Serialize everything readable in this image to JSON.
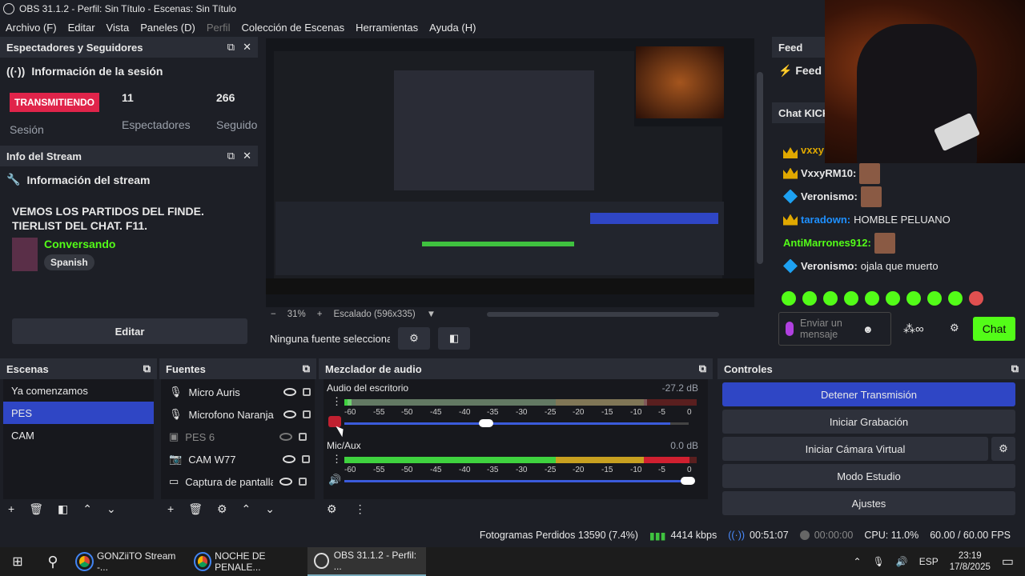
{
  "window": {
    "title": "OBS 31.1.2 - Perfil: Sin Título - Escenas: Sin Título"
  },
  "menu": {
    "items": [
      "Archivo (F)",
      "Editar",
      "Vista",
      "Paneles (D)",
      "Perfil",
      "Colección de Escenas",
      "Herramientas",
      "Ayuda (H)"
    ]
  },
  "viewers": {
    "title": "Espectadores y Seguidores",
    "session_header": "Información de la sesión",
    "status": "TRANSMITIENDO",
    "session_label": "Sesión",
    "viewers_count": "11",
    "viewers_label": "Espectadores",
    "followers_count": "266",
    "followers_label": "Seguido"
  },
  "stream_info": {
    "title": "Info del Stream",
    "header": "Información del stream",
    "stream_title": "VEMOS LOS PARTIDOS DEL FINDE. TIERLIST DEL CHAT. F11.",
    "category": "Conversando",
    "language": "Spanish",
    "edit_label": "Editar"
  },
  "preview": {
    "zoom": "31%",
    "scaling": "Escalado (596x335)",
    "no_source": "Ninguna fuente seleccionad"
  },
  "feed": {
    "title": "Feed",
    "sub": "Feed"
  },
  "chat": {
    "title": "Chat KICK",
    "messages": [
      {
        "user": "VxxyRM10:",
        "text": ""
      },
      {
        "user": "Veronismo:",
        "text": ""
      },
      {
        "user": "taradown:",
        "text": "HOMBLE PELUANO"
      },
      {
        "user": "AntiMarrones912:",
        "text": ""
      },
      {
        "user": "Veronismo:",
        "text": "ojala que muerto"
      }
    ],
    "input_placeholder": "Enviar un mensaje",
    "send_label": "Chat"
  },
  "scenes": {
    "title": "Escenas",
    "items": [
      "Ya comenzamos",
      "PES",
      "CAM"
    ],
    "selected": 1
  },
  "sources": {
    "title": "Fuentes",
    "items": [
      "Micro Auris",
      "Microfono Naranja",
      "PES 6",
      "CAM W77",
      "Captura de pantalla"
    ]
  },
  "mixer": {
    "title": "Mezclador de audio",
    "tracks": [
      {
        "name": "Audio del escritorio",
        "db": "-27.2 dB",
        "level": 0.02,
        "volume": 0.97
      },
      {
        "name": "Mic/Aux",
        "db": "0.0 dB",
        "level": 0.98,
        "volume": 1.0
      }
    ],
    "scale": [
      "-60",
      "-55",
      "-50",
      "-45",
      "-40",
      "-35",
      "-30",
      "-25",
      "-20",
      "-15",
      "-10",
      "-5",
      "0"
    ]
  },
  "controls": {
    "title": "Controles",
    "stop_stream": "Detener Transmisión",
    "start_record": "Iniciar Grabación",
    "virtual_cam": "Iniciar Cámara Virtual",
    "studio_mode": "Modo Estudio",
    "settings": "Ajustes"
  },
  "status": {
    "dropped": "Fotogramas Perdidos 13590 (7.4%)",
    "bitrate": "4414 kbps",
    "stream_time": "00:51:07",
    "record_time": "00:00:00",
    "cpu": "CPU: 11.0%",
    "fps": "60.00 / 60.00 FPS"
  },
  "taskbar": {
    "items": [
      "GONZiiTO Stream -...",
      "NOCHE DE PENALE...",
      "OBS 31.1.2 - Perfil: ..."
    ],
    "lang": "ESP",
    "time": "23:19",
    "date": "17/8/2025"
  }
}
